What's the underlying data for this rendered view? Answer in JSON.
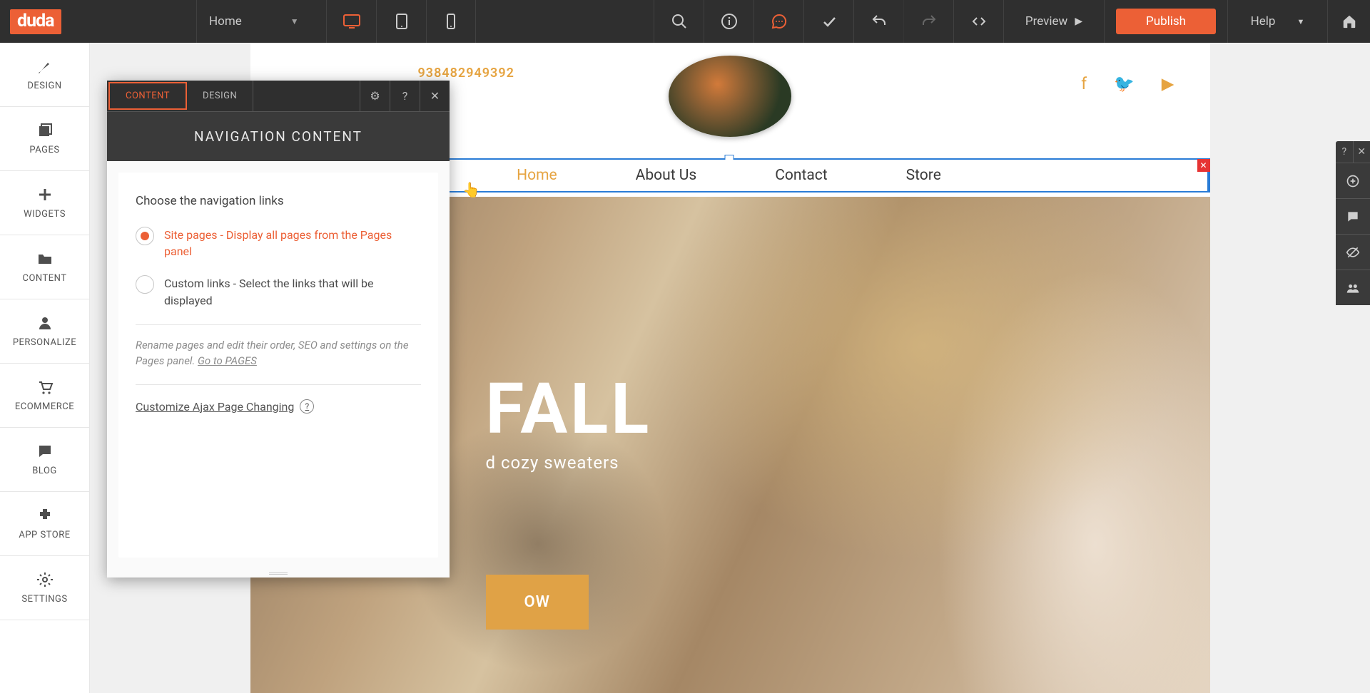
{
  "topbar": {
    "logo_text": "duda",
    "page_selector": "Home",
    "preview": "Preview",
    "publish": "Publish",
    "help": "Help"
  },
  "sidebar": {
    "items": [
      {
        "label": "DESIGN"
      },
      {
        "label": "PAGES"
      },
      {
        "label": "WIDGETS"
      },
      {
        "label": "CONTENT"
      },
      {
        "label": "PERSONALIZE"
      },
      {
        "label": "ECOMMERCE"
      },
      {
        "label": "BLOG"
      },
      {
        "label": "APP STORE"
      },
      {
        "label": "SETTINGS"
      }
    ]
  },
  "panel": {
    "tab_content": "CONTENT",
    "tab_design": "DESIGN",
    "title": "NAVIGATION CONTENT",
    "choose": "Choose the navigation links",
    "opt1": "Site pages - Display all pages from the Pages panel",
    "opt2": "Custom links - Select the links that will be displayed",
    "hint_pre": "Rename pages and edit their order, SEO and settings on the Pages panel. ",
    "hint_link": "Go to PAGES",
    "ajax": "Customize Ajax Page Changing",
    "help_icon": "?",
    "close_icon": "✕",
    "gear_icon": "⚙"
  },
  "site": {
    "phone": "938482949392",
    "nav": [
      "Home",
      "About Us",
      "Contact",
      "Store"
    ],
    "hero_title": "FALL",
    "hero_sub": "d cozy sweaters",
    "hero_btn": "OW"
  },
  "rail": {
    "q": "?",
    "x": "✕"
  }
}
